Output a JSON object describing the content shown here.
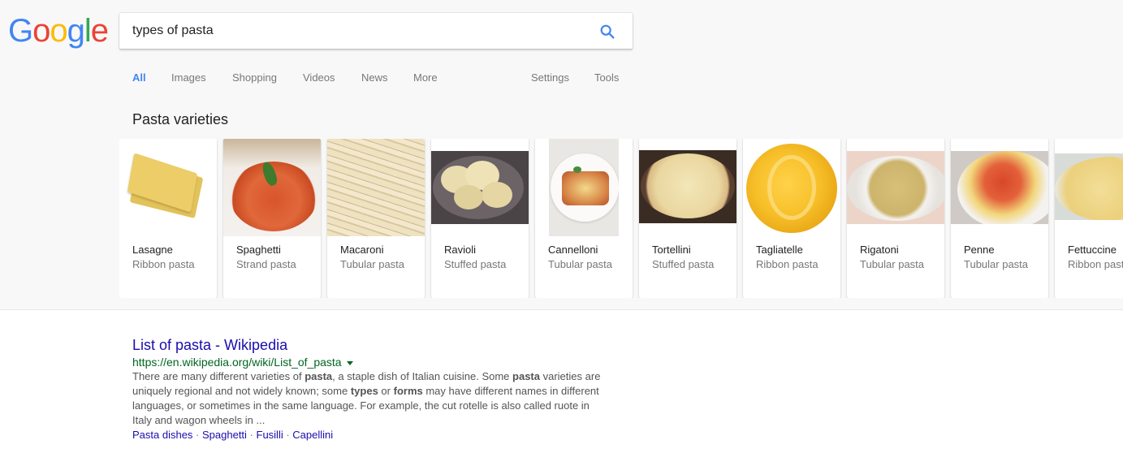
{
  "logo": {
    "text": "Google",
    "letters": [
      {
        "ch": "G",
        "color": "#4285F4"
      },
      {
        "ch": "o",
        "color": "#EA4335"
      },
      {
        "ch": "o",
        "color": "#FBBC05"
      },
      {
        "ch": "g",
        "color": "#4285F4"
      },
      {
        "ch": "l",
        "color": "#34A853"
      },
      {
        "ch": "e",
        "color": "#EA4335"
      }
    ]
  },
  "search": {
    "query": "types of pasta",
    "icon": "search-icon",
    "icon_color": "#4285F4"
  },
  "tabs": [
    {
      "label": "All",
      "active": true
    },
    {
      "label": "Images",
      "active": false
    },
    {
      "label": "Shopping",
      "active": false
    },
    {
      "label": "Videos",
      "active": false
    },
    {
      "label": "News",
      "active": false
    },
    {
      "label": "More",
      "active": false
    },
    {
      "label": "Settings",
      "active": false
    },
    {
      "label": "Tools",
      "active": false
    }
  ],
  "carousel": {
    "title": "Pasta varieties",
    "items": [
      {
        "name": "Lasagne",
        "type": "Ribbon pasta"
      },
      {
        "name": "Spaghetti",
        "type": "Strand pasta"
      },
      {
        "name": "Macaroni",
        "type": "Tubular pasta"
      },
      {
        "name": "Ravioli",
        "type": "Stuffed pasta"
      },
      {
        "name": "Cannelloni",
        "type": "Tubular pasta"
      },
      {
        "name": "Tortellini",
        "type": "Stuffed pasta"
      },
      {
        "name": "Tagliatelle",
        "type": "Ribbon pasta"
      },
      {
        "name": "Rigatoni",
        "type": "Tubular pasta"
      },
      {
        "name": "Penne",
        "type": "Tubular pasta"
      },
      {
        "name": "Fettuccine",
        "type": "Ribbon pasta"
      }
    ]
  },
  "results": [
    {
      "title": "List of pasta - Wikipedia",
      "url": "https://en.wikipedia.org/wiki/List_of_pasta",
      "snippet_parts": [
        {
          "t": "There are many different varieties of ",
          "b": false
        },
        {
          "t": "pasta",
          "b": true
        },
        {
          "t": ", a staple dish of Italian cuisine. Some ",
          "b": false
        },
        {
          "t": "pasta",
          "b": true
        },
        {
          "t": " varieties are uniquely regional and not widely known; some ",
          "b": false
        },
        {
          "t": "types",
          "b": true
        },
        {
          "t": " or ",
          "b": false
        },
        {
          "t": "forms",
          "b": true
        },
        {
          "t": " may have different names in different languages, or sometimes in the same language. For example, the cut rotelle is also called ruote in Italy and wagon wheels in ...",
          "b": false
        }
      ],
      "sitelinks": [
        "Pasta dishes",
        "Spaghetti",
        "Fusilli",
        "Capellini"
      ],
      "sitelink_separator": "·"
    }
  ]
}
